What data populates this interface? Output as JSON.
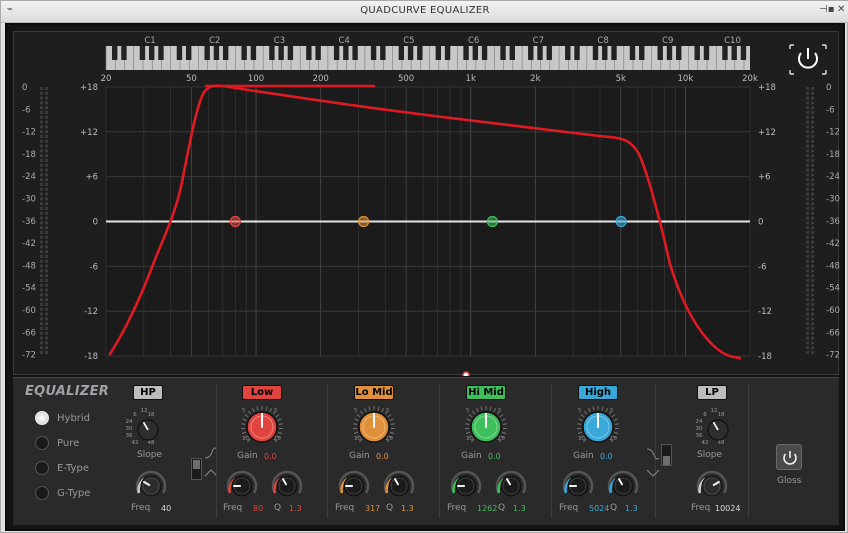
{
  "window": {
    "title": "QUADCURVE EQUALIZER",
    "pin_glyph": "⊣▪",
    "close_glyph": "✕",
    "menu_glyph": "⌁"
  },
  "piano": {
    "octaves": [
      "C1",
      "C2",
      "C3",
      "C4",
      "C5",
      "C6",
      "C7",
      "C8",
      "C9",
      "C10"
    ]
  },
  "freq_labels": [
    "20",
    "50",
    "100",
    "200",
    "500",
    "1k",
    "2k",
    "5k",
    "10k",
    "20k"
  ],
  "db_labels": [
    "+18",
    "+12",
    "+6",
    "0",
    "-6",
    "-12",
    "-18"
  ],
  "meter_labels": [
    "0",
    "-6",
    "-12",
    "-18",
    "-24",
    "-30",
    "-36",
    "-42",
    "-48",
    "-54",
    "-60",
    "-66",
    "-72"
  ],
  "controls": {
    "title": "EQUALIZER",
    "modes": [
      "Hybrid",
      "Pure",
      "E-Type",
      "G-Type"
    ],
    "selected_mode": "Hybrid",
    "hp": {
      "label": "HP",
      "slope_label": "Slope",
      "slope_ticks": [
        "6",
        "12",
        "18",
        "24",
        "30",
        "36",
        "42",
        "48"
      ],
      "freq_label": "Freq",
      "freq_value": "40"
    },
    "low": {
      "label": "Low",
      "gain_label": "Gain",
      "gain_value": "0.0",
      "freq_label": "Freq",
      "freq_value": "80",
      "q_label": "Q",
      "q_value": "1.3",
      "color": "#e0443f"
    },
    "lomid": {
      "label": "Lo Mid",
      "gain_label": "Gain",
      "gain_value": "0.0",
      "freq_label": "Freq",
      "freq_value": "317",
      "q_label": "Q",
      "q_value": "1.3",
      "color": "#e0903a"
    },
    "himid": {
      "label": "Hi Mid",
      "gain_label": "Gain",
      "gain_value": "0.0",
      "freq_label": "Freq",
      "freq_value": "1262",
      "q_label": "Q",
      "q_value": "1.3",
      "color": "#3fbf5c"
    },
    "high": {
      "label": "High",
      "gain_label": "Gain",
      "gain_value": "0.0",
      "freq_label": "Freq",
      "freq_value": "5024",
      "q_label": "Q",
      "q_value": "1.3",
      "color": "#38a8d8"
    },
    "lp": {
      "label": "LP",
      "slope_label": "Slope",
      "slope_ticks": [
        "6",
        "12",
        "18",
        "24",
        "30",
        "36",
        "42",
        "48"
      ],
      "freq_label": "Freq",
      "freq_value": "10024"
    },
    "gain_ticks": [
      "5",
      "10",
      "10",
      "5"
    ],
    "gloss_label": "Gloss"
  }
}
